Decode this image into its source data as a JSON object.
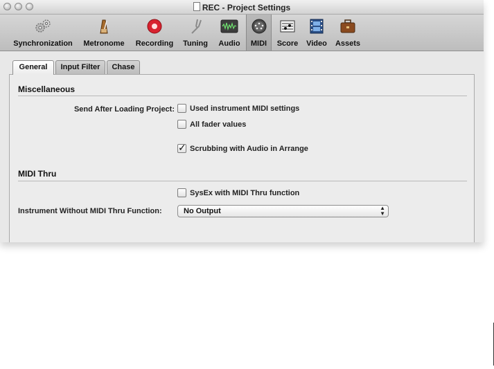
{
  "window": {
    "title": "REC - Project Settings"
  },
  "toolbar": {
    "items": [
      {
        "label": "Synchronization",
        "icon": "gears-icon"
      },
      {
        "label": "Metronome",
        "icon": "metronome-icon"
      },
      {
        "label": "Recording",
        "icon": "record-icon"
      },
      {
        "label": "Tuning",
        "icon": "tuning-fork-icon"
      },
      {
        "label": "Audio",
        "icon": "audio-waveform-icon"
      },
      {
        "label": "MIDI",
        "icon": "midi-connector-icon",
        "selected": true
      },
      {
        "label": "Score",
        "icon": "score-icon"
      },
      {
        "label": "Video",
        "icon": "film-icon"
      },
      {
        "label": "Assets",
        "icon": "briefcase-icon"
      }
    ]
  },
  "tabs": [
    {
      "label": "General",
      "active": true
    },
    {
      "label": "Input Filter",
      "active": false
    },
    {
      "label": "Chase",
      "active": false
    }
  ],
  "misc": {
    "title": "Miscellaneous",
    "send_label": "Send After Loading Project:",
    "used_instrument": {
      "label": "Used instrument MIDI settings",
      "checked": false
    },
    "all_fader": {
      "label": "All fader values",
      "checked": false
    },
    "scrubbing": {
      "label": "Scrubbing with Audio in Arrange",
      "checked": true
    }
  },
  "midi_thru": {
    "title": "MIDI Thru",
    "sysex": {
      "label": "SysEx with MIDI Thru function",
      "checked": false
    },
    "instrument_label": "Instrument Without MIDI Thru Function:",
    "instrument_value": "No Output"
  },
  "colors": {
    "record": "#d8222f",
    "window_bg": "#e8e8e8"
  }
}
